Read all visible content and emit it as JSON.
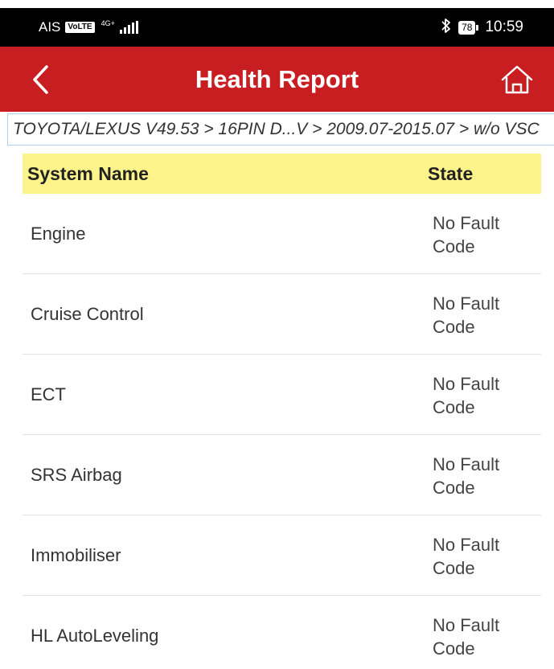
{
  "status_bar": {
    "carrier": "AIS",
    "volte": "VoLTE",
    "network": "4G+",
    "battery": "78",
    "time": "10:59"
  },
  "app_bar": {
    "title": "Health Report",
    "back_icon": "chevron-left-icon",
    "home_icon": "home-icon"
  },
  "breadcrumb": "TOYOTA/LEXUS V49.53 > 16PIN D...V > 2009.07-2015.07 > w/o VSC",
  "table": {
    "headers": {
      "name": "System Name",
      "state": "State"
    },
    "header_color": "#fcf38a",
    "rows": [
      {
        "name": "Engine",
        "state": "No Fault Code"
      },
      {
        "name": "Cruise Control",
        "state": "No Fault Code"
      },
      {
        "name": "ECT",
        "state": "No Fault Code"
      },
      {
        "name": "SRS Airbag",
        "state": "No Fault Code"
      },
      {
        "name": "Immobiliser",
        "state": "No Fault Code"
      },
      {
        "name": "HL AutoLeveling",
        "state": "No Fault Code"
      }
    ]
  },
  "colors": {
    "accent": "#c81e21",
    "status_bar": "#000000"
  }
}
